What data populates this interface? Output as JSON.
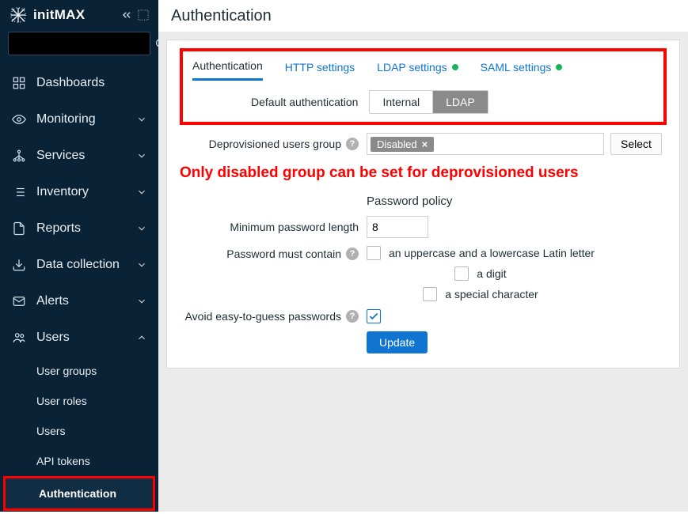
{
  "brand": "initMAX",
  "search_placeholder": "",
  "nav": [
    {
      "label": "Dashboards",
      "expandable": false
    },
    {
      "label": "Monitoring",
      "expandable": true
    },
    {
      "label": "Services",
      "expandable": true
    },
    {
      "label": "Inventory",
      "expandable": true
    },
    {
      "label": "Reports",
      "expandable": true
    },
    {
      "label": "Data collection",
      "expandable": true
    },
    {
      "label": "Alerts",
      "expandable": true
    }
  ],
  "users_section": {
    "label": "Users",
    "items": [
      "User groups",
      "User roles",
      "Users",
      "API tokens",
      "Authentication"
    ],
    "active": "Authentication"
  },
  "page": {
    "title": "Authentication",
    "tabs": [
      "Authentication",
      "HTTP settings",
      "LDAP settings",
      "SAML settings"
    ],
    "active_tab": "Authentication",
    "dot_tabs": [
      "LDAP settings",
      "SAML settings"
    ],
    "default_auth_label": "Default authentication",
    "default_auth_options": [
      "Internal",
      "LDAP"
    ],
    "default_auth_selected": "LDAP",
    "deprov_label": "Deprovisioned users group",
    "deprov_chip": "Disabled",
    "select_btn": "Select",
    "annotation": "Only disabled group can be set for deprovisioned users",
    "password_policy_title": "Password policy",
    "min_len_label": "Minimum password length",
    "min_len_value": "8",
    "must_contain_label": "Password must contain",
    "must_contain_opts": [
      "an uppercase and a lowercase Latin letter",
      "a digit",
      "a special character"
    ],
    "avoid_label": "Avoid easy-to-guess passwords",
    "avoid_checked": true,
    "update_btn": "Update"
  }
}
